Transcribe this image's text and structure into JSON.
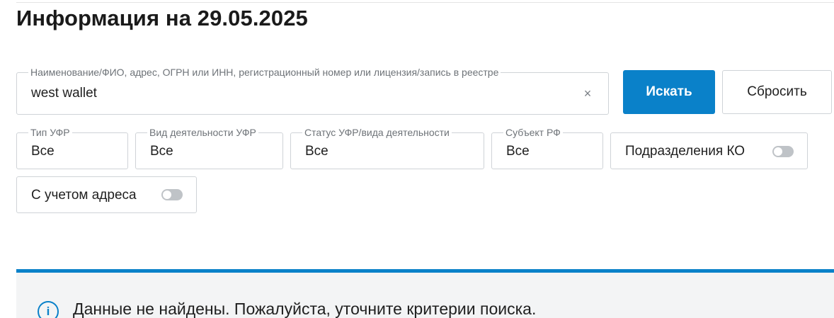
{
  "page": {
    "title": "Информация на 29.05.2025"
  },
  "search": {
    "label": "Наименование/ФИО, адрес, ОГРН или ИНН, регистрационный номер или лицензия/запись в реестре",
    "value": "west wallet",
    "clear_icon": "×"
  },
  "buttons": {
    "search_label": "Искать",
    "reset_label": "Сбросить"
  },
  "filters": [
    {
      "label": "Тип УФР",
      "value": "Все"
    },
    {
      "label": "Вид деятельности УФР",
      "value": "Все"
    },
    {
      "label": "Статус УФР/вида деятельности",
      "value": "Все"
    },
    {
      "label": "Субъект РФ",
      "value": "Все"
    }
  ],
  "toggles": [
    {
      "label": "Подразделения КО",
      "state": "off"
    },
    {
      "label": "С учетом адреса",
      "state": "off"
    }
  ],
  "notice": {
    "icon": "i",
    "text": "Данные не найдены. Пожалуйста, уточните критерии поиска."
  },
  "colors": {
    "accent": "#0a81c9",
    "border": "#cfd3d7",
    "notice_bg": "#f3f4f5"
  }
}
